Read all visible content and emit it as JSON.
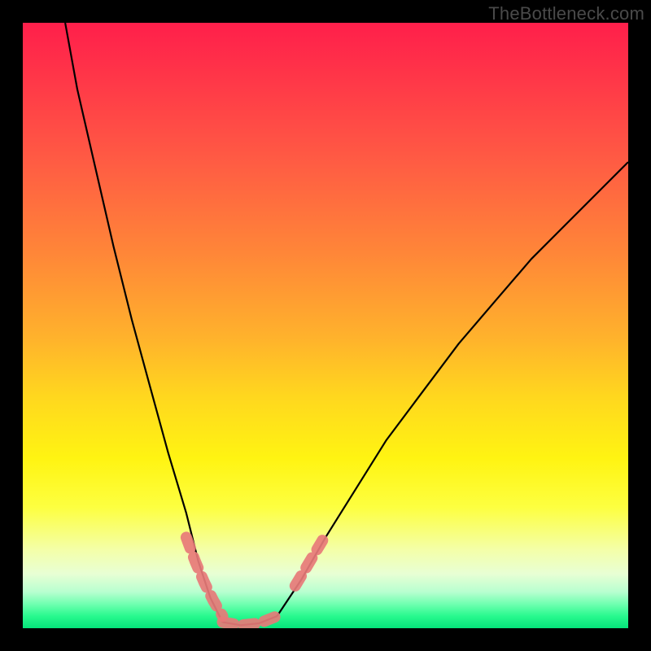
{
  "watermark": "TheBottleneck.com",
  "chart_data": {
    "type": "line",
    "title": "",
    "xlabel": "",
    "ylabel": "",
    "xlim": [
      0,
      100
    ],
    "ylim": [
      0,
      100
    ],
    "grid": false,
    "legend": false,
    "notes": "Bottleneck-style curve plot on a rainbow gradient background. No axis ticks or labels are visible; x/y are normalized 0-100 across the plot area. Two black curves descend into a minimum between x≈31 and x≈42; the right curve rises monotonically to the top-right edge. Small coral dashed segments mark the near-optimal basin and flanking transitions.",
    "series": [
      {
        "name": "curve-left",
        "color": "#000000",
        "x": [
          7,
          9,
          12,
          15,
          18,
          21,
          24,
          27,
          29,
          31,
          33
        ],
        "y": [
          100,
          89,
          76,
          63,
          51,
          40,
          29,
          19,
          11,
          5,
          1
        ]
      },
      {
        "name": "basin-flat",
        "color": "#000000",
        "x": [
          33,
          36,
          39,
          42
        ],
        "y": [
          1,
          0.5,
          0.8,
          2
        ]
      },
      {
        "name": "curve-right",
        "color": "#000000",
        "x": [
          42,
          46,
          50,
          55,
          60,
          66,
          72,
          78,
          84,
          90,
          96,
          100
        ],
        "y": [
          2,
          8,
          15,
          23,
          31,
          39,
          47,
          54,
          61,
          67,
          73,
          77
        ]
      },
      {
        "name": "marker-left-flank",
        "color": "#e77a78",
        "style": "dashed-thick",
        "x": [
          27,
          28.5,
          30,
          31.5,
          33
        ],
        "y": [
          15,
          11,
          7.5,
          4.5,
          2
        ]
      },
      {
        "name": "marker-basin",
        "color": "#e77a78",
        "style": "dashed-thick",
        "x": [
          33,
          36,
          39,
          42
        ],
        "y": [
          1,
          0.5,
          0.8,
          2
        ]
      },
      {
        "name": "marker-right-flank",
        "color": "#e77a78",
        "style": "dashed-thick",
        "x": [
          45,
          46.5,
          48,
          49.5
        ],
        "y": [
          7,
          9.5,
          12,
          14.5
        ]
      }
    ]
  }
}
